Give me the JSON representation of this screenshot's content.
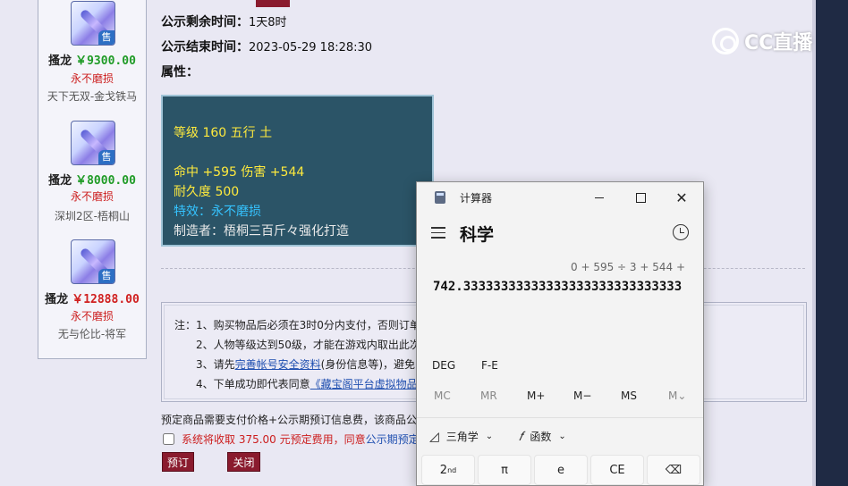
{
  "item_list": [
    {
      "seller": "搔龙",
      "price": "￥9300.00",
      "price_color": "green",
      "wear": "永不磨损",
      "server": "天下无双-金戈铁马",
      "badge": "售"
    },
    {
      "seller": "搔龙",
      "price": "￥8000.00",
      "price_color": "green",
      "wear": "永不磨损",
      "server": "深圳2区-梧桐山",
      "badge": "售"
    },
    {
      "seller": "搔龙",
      "price": "￥12888.00",
      "price_color": "red",
      "wear": "永不磨损",
      "server": "无与伦比-将军",
      "badge": "售"
    }
  ],
  "info": {
    "remaining_label": "公示剩余时间：",
    "remaining_value": "1天8时",
    "end_label": "公示结束时间：",
    "end_value": "2023-05-29 18:28:30",
    "attr_label": "属性："
  },
  "attributes": {
    "line1": "等级 160 五行 土",
    "line2": "命中 +595 伤害 +544",
    "line3": "耐久度 500",
    "line4": "特效：永不磨损",
    "line5": "制造者：梧桐三百斤々强化打造"
  },
  "notice": {
    "line1": "注：1、购买物品后必须在3时0分内支付，否则订单",
    "line2": "2、人物等级达到50级，才能在游戏内取出此次",
    "line3_pre": "3、请先",
    "line3_link": "完善帐号安全资料",
    "line3_post": "(身份信息等)，避免",
    "line4_pre": "4、下单成功即代表同意",
    "line4_link": "《藏宝阁平台虚拟物品"
  },
  "prepay_text": "预定商品需要支付价格+公示期预订信息费，该商品公示",
  "agree": {
    "text": "系统将收取 375.00 元预定费用，同意",
    "link": "公示期预定服"
  },
  "buttons": {
    "reserve": "预订",
    "close": "关闭"
  },
  "watermark": "CC直播",
  "calculator": {
    "title": "计算器",
    "mode": "科学",
    "expression": "0 + 595 ÷ 3 + 544 +",
    "result": "742.33333333333333333333333333333",
    "deg": "DEG",
    "fe": "F-E",
    "memory": [
      "MC",
      "MR",
      "M+",
      "M−",
      "MS",
      "M⌄"
    ],
    "trig_label": "三角学",
    "func_label": "函数",
    "keys": [
      "2nd",
      "π",
      "e",
      "CE",
      "⌫"
    ]
  }
}
